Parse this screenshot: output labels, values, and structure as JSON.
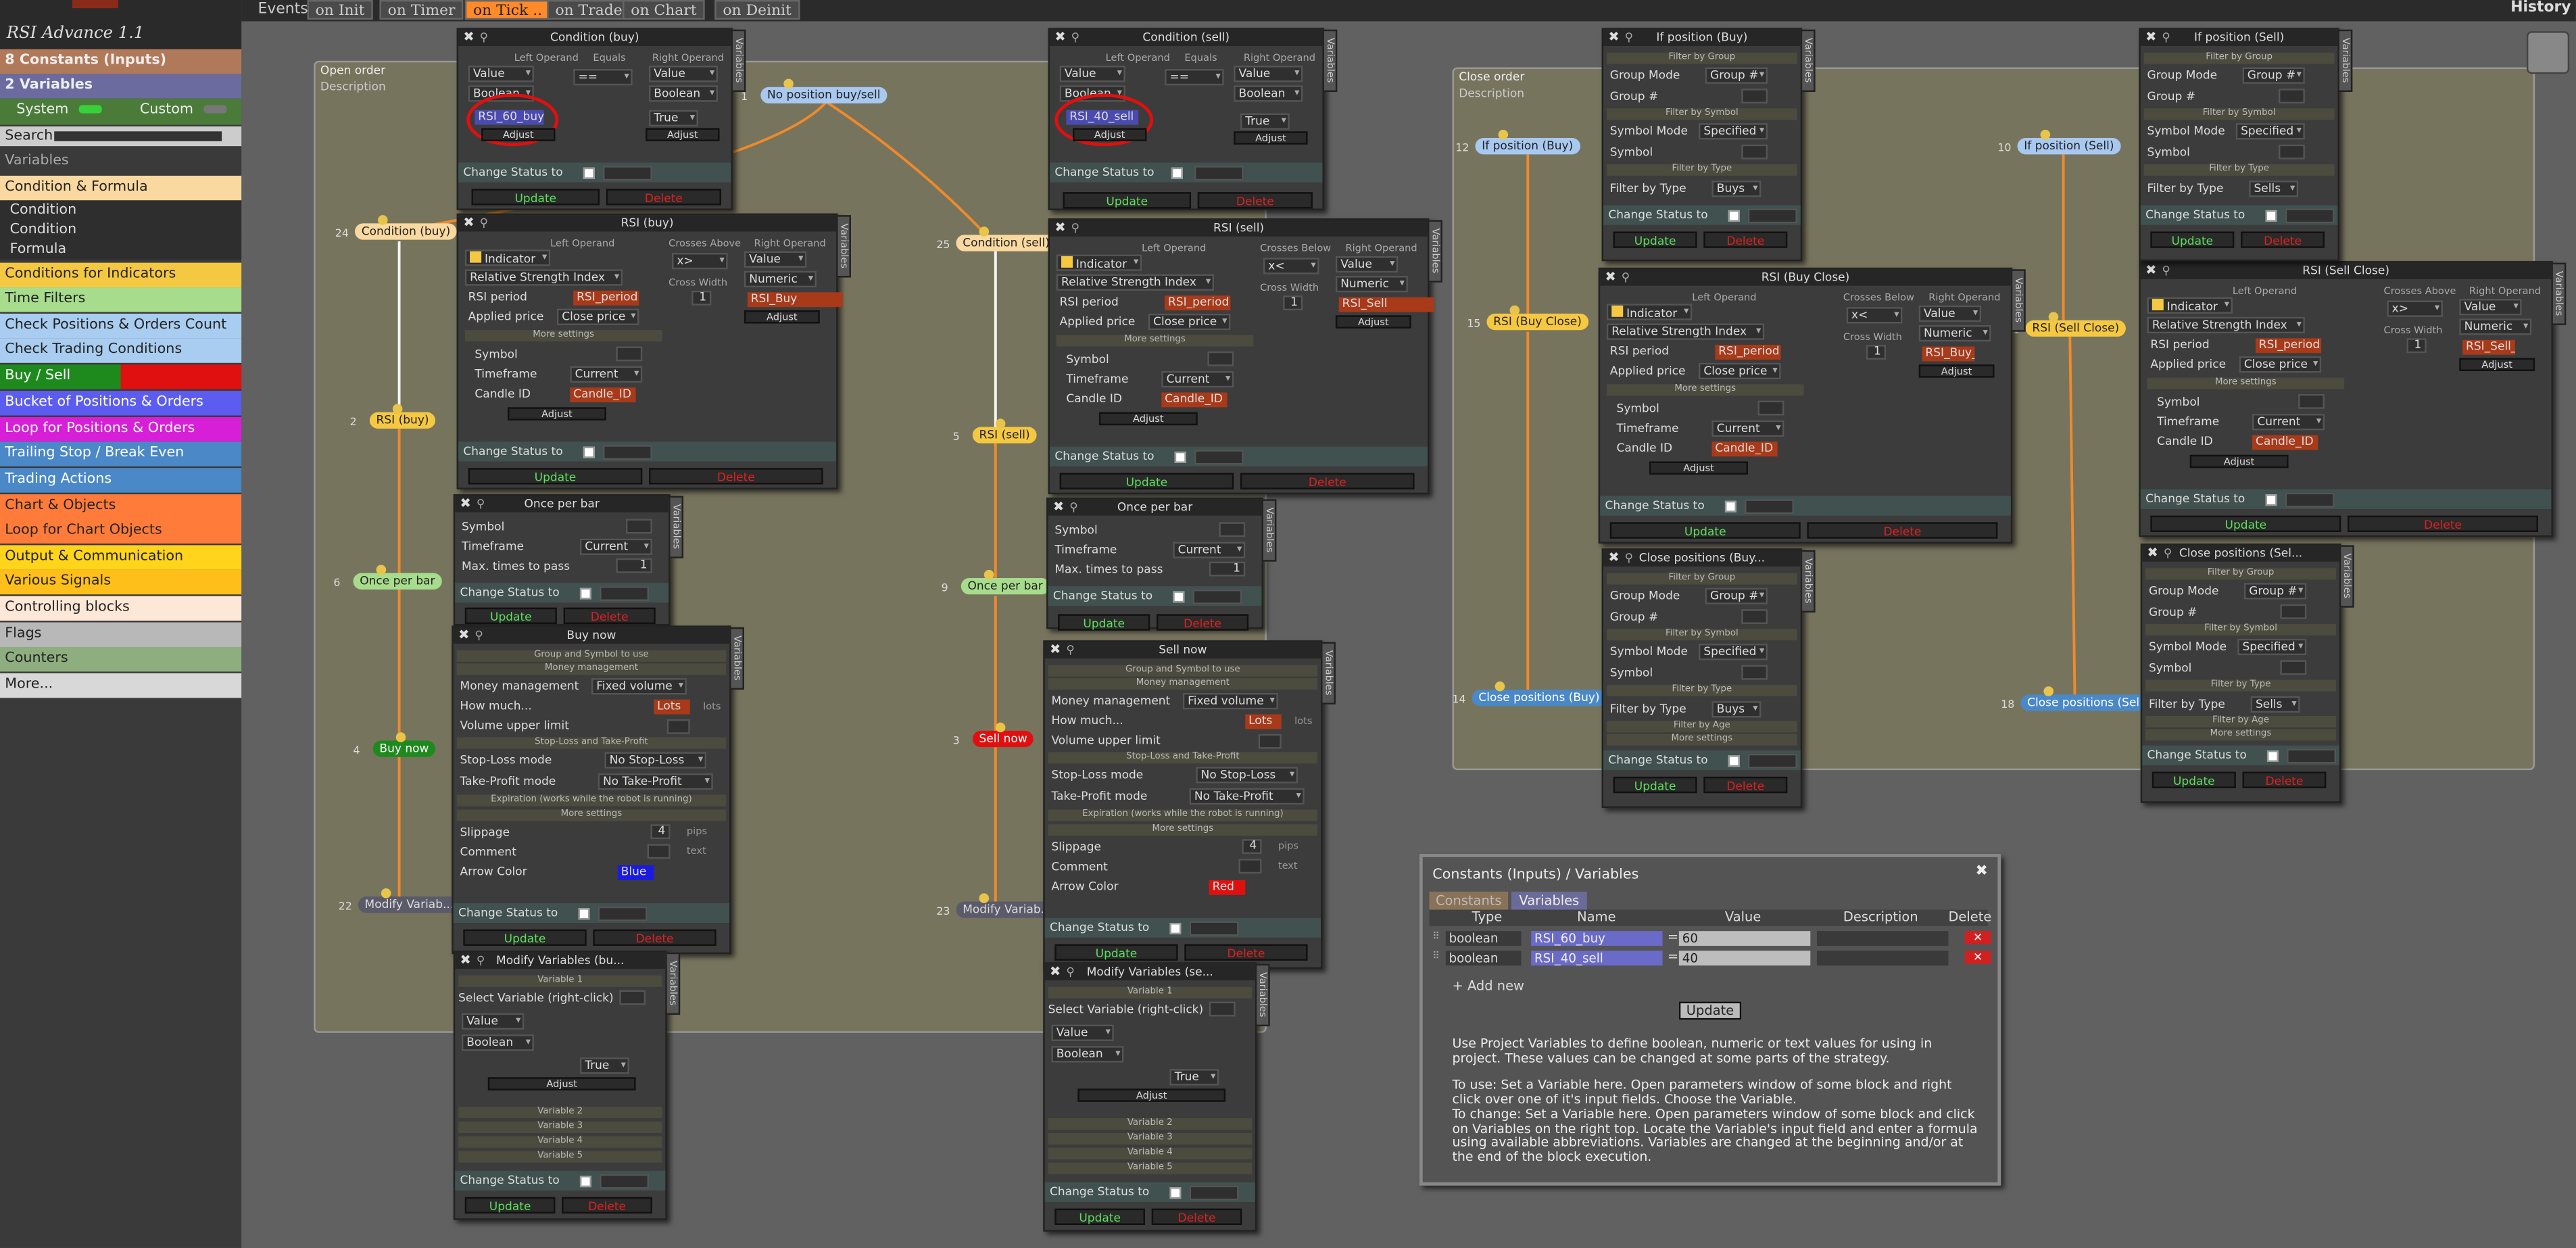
{
  "app_title": "RSI Advance 1.1",
  "history_label": "History",
  "sidebar": {
    "constants": "Constants (Inputs)",
    "constants_count": "8",
    "variables": "Variables",
    "variables_count": "2",
    "system_label": "System",
    "custom_label": "Custom",
    "search_label": "Search:",
    "section_label": "Variables",
    "categories": [
      {
        "label": "Condition & Formula",
        "bg": "#f9d9a0",
        "fg": "#222"
      },
      {
        "label": "Condition",
        "bg": "#2e2e2e",
        "fg": "#ddd"
      },
      {
        "label": "Condition",
        "bg": "#2e2e2e",
        "fg": "#ddd"
      },
      {
        "label": "Formula",
        "bg": "#2e2e2e",
        "fg": "#ddd"
      },
      {
        "label": "Conditions for Indicators",
        "bg": "#f5c842",
        "fg": "#222"
      },
      {
        "label": "Time Filters",
        "bg": "#a7dc8c",
        "fg": "#222"
      },
      {
        "label": "Check Positions & Orders Count",
        "bg": "#a9cdf0",
        "fg": "#222"
      },
      {
        "label": "Check Trading Conditions",
        "bg": "#a9cdf0",
        "fg": "#222"
      },
      {
        "label": "Buy / Sell",
        "bg": "#1e8a1e",
        "fg": "#fff"
      },
      {
        "label": "Bucket of Positions & Orders",
        "bg": "#5c5cf0",
        "fg": "#fff"
      },
      {
        "label": "Loop for Positions & Orders",
        "bg": "#d81fd8",
        "fg": "#fff"
      },
      {
        "label": "Trailing Stop / Break Even",
        "bg": "#4a88c8",
        "fg": "#fff"
      },
      {
        "label": "Trading Actions",
        "bg": "#4a88c8",
        "fg": "#fff"
      },
      {
        "label": "Chart & Objects",
        "bg": "#ff7b3a",
        "fg": "#222"
      },
      {
        "label": "Loop for Chart Objects",
        "bg": "#ff7b3a",
        "fg": "#222"
      },
      {
        "label": "Output & Communication",
        "bg": "#ffd41a",
        "fg": "#222"
      },
      {
        "label": "Various Signals",
        "bg": "#ffbf1a",
        "fg": "#222"
      },
      {
        "label": "Controlling blocks",
        "bg": "#fde8d8",
        "fg": "#222"
      },
      {
        "label": "Flags",
        "bg": "#b8b8b8",
        "fg": "#222"
      },
      {
        "label": "Counters",
        "bg": "#8fae7f",
        "fg": "#222"
      },
      {
        "label": "More...",
        "bg": "#d8d8d8",
        "fg": "#222"
      }
    ]
  },
  "events": {
    "label": "Events",
    "tabs": [
      "on Init",
      "on Timer",
      "on Tick ..",
      "on Trade",
      "on Chart",
      "on Deinit"
    ]
  },
  "groups": {
    "open": "Open order",
    "open_desc": "Description",
    "close": "Close order",
    "close_desc": "Description"
  },
  "nodes": {
    "n1": {
      "num": "1",
      "label": "No position buy/sell"
    },
    "n24": {
      "num": "24",
      "label": "Condition (buy)"
    },
    "n25": {
      "num": "25",
      "label": "Condition (sell)"
    },
    "n2": {
      "num": "2",
      "label": "RSI (buy)"
    },
    "n5": {
      "num": "5",
      "label": "RSI (sell)"
    },
    "n6": {
      "num": "6",
      "label": "Once per bar"
    },
    "n9": {
      "num": "9",
      "label": "Once per bar"
    },
    "n4": {
      "num": "4",
      "label": "Buy now"
    },
    "n3": {
      "num": "3",
      "label": "Sell now"
    },
    "n22": {
      "num": "22",
      "label": "Modify Variab..."
    },
    "n23": {
      "num": "23",
      "label": "Modify Variab..."
    },
    "n12": {
      "num": "12",
      "label": "If position (Buy)"
    },
    "n10": {
      "num": "10",
      "label": "If position (Sell)"
    },
    "n15": {
      "num": "15",
      "label": "RSI (Buy Close)"
    },
    "n11": {
      "num": "11",
      "label": "RSI (Sell Close)"
    },
    "n14": {
      "num": "14",
      "label": "Close positions (Buy)"
    },
    "n18": {
      "num": "18",
      "label": "Close positions (Sel..."
    }
  },
  "common": {
    "update": "Update",
    "delete": "Delete",
    "change_status": "Change Status to",
    "adjust": "Adjust",
    "variables_tab": "Variables",
    "left_operand": "Left Operand",
    "right_operand": "Right Operand",
    "equals": "Equals",
    "crosses_above": "Crosses Above",
    "crosses_below": "Crosses Below",
    "cross_width": "Cross Width",
    "more_settings": "More settings",
    "filter_group": "Filter by Group",
    "filter_symbol": "Filter by Symbol",
    "filter_type": "Filter by Type",
    "filter_age": "Filter by Age"
  },
  "cond_buy": {
    "title": "Condition (buy)",
    "left_type": "Value",
    "left_kind": "Boolean",
    "left_var": "RSI_60_buy",
    "op": "==",
    "right_type": "Value",
    "right_kind": "Boolean",
    "right_val": "True"
  },
  "cond_sell": {
    "title": "Condition (sell)",
    "left_type": "Value",
    "left_kind": "Boolean",
    "left_var": "RSI_40_sell",
    "op": "==",
    "right_type": "Value",
    "right_kind": "Boolean",
    "right_val": "True"
  },
  "rsi_buy": {
    "title": "RSI (buy)",
    "type": "Indicator",
    "ind": "Relative Strength Index",
    "period_label": "RSI period",
    "period": "RSI_period",
    "applied_label": "Applied price",
    "applied": "Close price",
    "op": "x>",
    "right_type": "Value",
    "right_kind": "Numeric",
    "right_var": "RSI_Buy",
    "cw": "1",
    "symbol": "Symbol",
    "timeframe_label": "Timeframe",
    "timeframe": "Current",
    "candle_label": "Candle ID",
    "candle": "Candle_ID"
  },
  "rsi_sell": {
    "title": "RSI (sell)",
    "type": "Indicator",
    "ind": "Relative Strength Index",
    "period_label": "RSI period",
    "period": "RSI_period",
    "applied_label": "Applied price",
    "applied": "Close price",
    "op": "x<",
    "right_type": "Value",
    "right_kind": "Numeric",
    "right_var": "RSI_Sell",
    "cw": "1",
    "symbol": "Symbol",
    "timeframe_label": "Timeframe",
    "timeframe": "Current",
    "candle_label": "Candle ID",
    "candle": "Candle_ID"
  },
  "once_buy": {
    "title": "Once per bar",
    "symbol": "Symbol",
    "timeframe_label": "Timeframe",
    "timeframe": "Current",
    "max_label": "Max. times to pass",
    "max": "1"
  },
  "once_sell": {
    "title": "Once per bar",
    "symbol": "Symbol",
    "timeframe_label": "Timeframe",
    "timeframe": "Current",
    "max_label": "Max. times to pass",
    "max": "1"
  },
  "buy_now": {
    "title": "Buy now",
    "group_symbol": "Group and Symbol to use",
    "money_sect": "Money management",
    "money_label": "Money management",
    "money": "Fixed volume",
    "how_label": "How much...",
    "how": "Lots",
    "lots": "lots",
    "vol_label": "Volume upper limit",
    "sltp": "Stop-Loss and Take-Profit",
    "sl_label": "Stop-Loss mode",
    "sl": "No Stop-Loss",
    "tp_label": "Take-Profit mode",
    "tp": "No Take-Profit",
    "exp": "Expiration (works while the robot is running)",
    "slip_label": "Slippage",
    "slip": "4",
    "pips": "pips",
    "comment_label": "Comment",
    "text": "text",
    "arrow_label": "Arrow Color",
    "arrow": "Blue"
  },
  "sell_now": {
    "title": "Sell now",
    "group_symbol": "Group and Symbol to use",
    "money_sect": "Money management",
    "money_label": "Money management",
    "money": "Fixed volume",
    "how_label": "How much...",
    "how": "Lots",
    "lots": "lots",
    "vol_label": "Volume upper limit",
    "sltp": "Stop-Loss and Take-Profit",
    "sl_label": "Stop-Loss mode",
    "sl": "No Stop-Loss",
    "tp_label": "Take-Profit mode",
    "tp": "No Take-Profit",
    "exp": "Expiration (works while the robot is running)",
    "slip_label": "Slippage",
    "slip": "4",
    "pips": "pips",
    "comment_label": "Comment",
    "text": "text",
    "arrow_label": "Arrow Color",
    "arrow": "Red"
  },
  "mod_buy": {
    "title": "Modify Variables (bu...",
    "v1": "Variable 1",
    "sel_label": "Select Variable (right-click)",
    "type": "Value",
    "kind": "Boolean",
    "val": "True",
    "v2": "Variable 2",
    "v3": "Variable 3",
    "v4": "Variable 4",
    "v5": "Variable 5"
  },
  "mod_sell": {
    "title": "Modify Variables (se...",
    "v1": "Variable 1",
    "sel_label": "Select Variable (right-click)",
    "type": "Value",
    "kind": "Boolean",
    "val": "True",
    "v2": "Variable 2",
    "v3": "Variable 3",
    "v4": "Variable 4",
    "v5": "Variable 5"
  },
  "ifpos_buy": {
    "title": "If position (Buy)",
    "gm_label": "Group Mode",
    "gm": "Group #",
    "g_label": "Group #",
    "sm_label": "Symbol Mode",
    "sm": "Specified",
    "sym_label": "Symbol",
    "ft_label": "Filter by Type",
    "ft": "Buys"
  },
  "ifpos_sell": {
    "title": "If position (Sell)",
    "gm_label": "Group Mode",
    "gm": "Group #",
    "g_label": "Group #",
    "sm_label": "Symbol Mode",
    "sm": "Specified",
    "sym_label": "Symbol",
    "ft_label": "Filter by Type",
    "ft": "Sells"
  },
  "rsi_bc": {
    "title": "RSI (Buy Close)",
    "type": "Indicator",
    "ind": "Relative Strength Index",
    "period_label": "RSI period",
    "period": "RSI_period",
    "applied_label": "Applied price",
    "applied": "Close price",
    "op": "x<",
    "right_type": "Value",
    "right_kind": "Numeric",
    "right_var": "RSI_Buy_Close",
    "cw": "1",
    "symbol": "Symbol",
    "timeframe_label": "Timeframe",
    "timeframe": "Current",
    "candle_label": "Candle ID",
    "candle": "Candle_ID"
  },
  "rsi_sc": {
    "title": "RSI (Sell Close)",
    "type": "Indicator",
    "ind": "Relative Strength Index",
    "period_label": "RSI period",
    "period": "RSI_period",
    "applied_label": "Applied price",
    "applied": "Close price",
    "op": "x>",
    "right_type": "Value",
    "right_kind": "Numeric",
    "right_var": "RSI_Sell_Close",
    "cw": "1",
    "symbol": "Symbol",
    "timeframe_label": "Timeframe",
    "timeframe": "Current",
    "candle_label": "Candle ID",
    "candle": "Candle_ID"
  },
  "close_buy": {
    "title": "Close positions (Buy...",
    "gm_label": "Group Mode",
    "gm": "Group #",
    "g_label": "Group #",
    "sm_label": "Symbol Mode",
    "sm": "Specified",
    "sym_label": "Symbol",
    "ft_label": "Filter by Type",
    "ft": "Buys"
  },
  "close_sell": {
    "title": "Close positions (Sel...",
    "gm_label": "Group Mode",
    "gm": "Group #",
    "g_label": "Group #",
    "sm_label": "Symbol Mode",
    "sm": "Specified",
    "sym_label": "Symbol",
    "ft_label": "Filter by Type",
    "ft": "Sells"
  },
  "consts": {
    "title": "Constants (Inputs) / Variables",
    "tab1": "Constants",
    "tab2": "Variables",
    "h_type": "Type",
    "h_name": "Name",
    "h_value": "Value",
    "h_desc": "Description",
    "h_del": "Delete",
    "rows": [
      {
        "type": "boolean",
        "name": "RSI_60_buy",
        "eq": "=",
        "value": "60"
      },
      {
        "type": "boolean",
        "name": "RSI_40_sell",
        "eq": "=",
        "value": "40"
      }
    ],
    "add": "+ Add new",
    "update": "Update",
    "help1": "Use Project Variables to define boolean, numeric or text values for using in project. These values can be changed at some parts of the strategy.",
    "help2": "To use: Set a Variable here. Open parameters window of some block and right click over one of it's input fields. Choose the Variable.",
    "help3": "To change: Set a Variable here. Open parameters window of some block and click on Variables on the right top. Locate the Variable's input field and enter a formula using available abbreviations. Variables are changed at the beginning and/or at the end of the block execution."
  }
}
